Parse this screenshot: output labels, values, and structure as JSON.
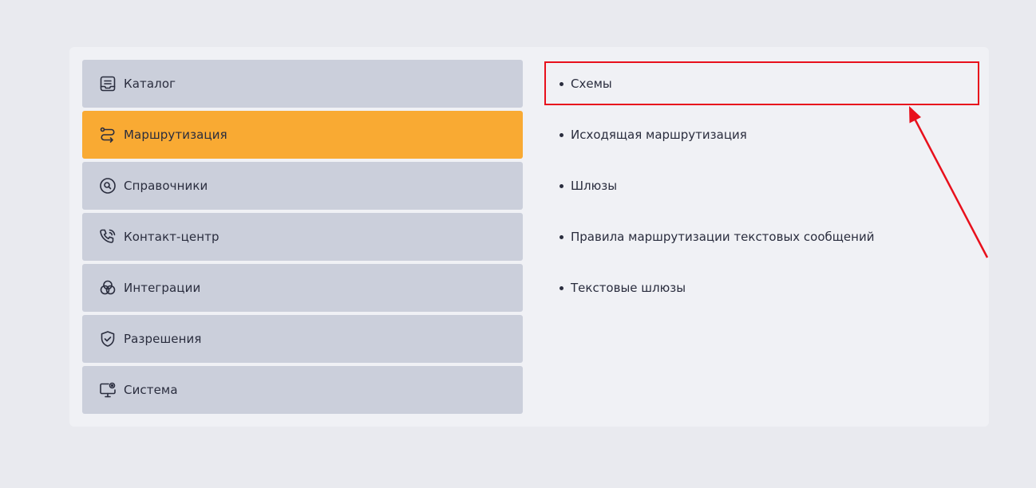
{
  "menu": {
    "items": [
      {
        "label": "Каталог",
        "icon": "catalog-icon",
        "active": false
      },
      {
        "label": "Маршрутизация",
        "icon": "routing-icon",
        "active": true
      },
      {
        "label": "Справочники",
        "icon": "search-circle-icon",
        "active": false
      },
      {
        "label": "Контакт-центр",
        "icon": "phone-icon",
        "active": false
      },
      {
        "label": "Интеграции",
        "icon": "integrations-icon",
        "active": false
      },
      {
        "label": "Разрешения",
        "icon": "shield-check-icon",
        "active": false
      },
      {
        "label": "Система",
        "icon": "monitor-icon",
        "active": false
      }
    ]
  },
  "submenu": {
    "items": [
      {
        "label": "Схемы"
      },
      {
        "label": "Исходящая маршрутизация"
      },
      {
        "label": "Шлюзы"
      },
      {
        "label": "Правила маршрутизации текстовых сообщений"
      },
      {
        "label": "Текстовые шлюзы"
      }
    ]
  },
  "colors": {
    "background": "#e9eaef",
    "panel": "#f0f1f5",
    "menu_item": "#cbcfdb",
    "menu_item_active": "#f9aa33",
    "text": "#2a2d3e",
    "annotation": "#e8101c"
  }
}
